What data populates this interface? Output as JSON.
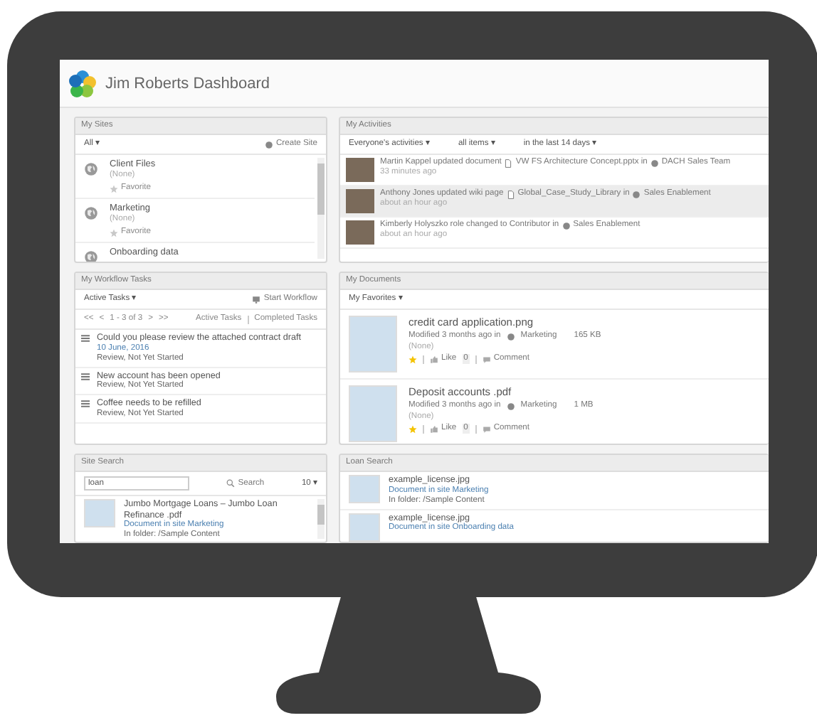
{
  "header": {
    "title": "Jim Roberts Dashboard"
  },
  "my_sites": {
    "title": "My Sites",
    "filter": "All ▾",
    "create": "Create Site",
    "items": [
      {
        "name": "Client Files",
        "description": "(None)",
        "favorite_label": "Favorite",
        "favorite": false
      },
      {
        "name": "Marketing",
        "description": "(None)",
        "favorite_label": "Favorite",
        "favorite": false
      },
      {
        "name": "Onboarding data"
      }
    ]
  },
  "my_activities": {
    "title": "My Activities",
    "filters": [
      "Everyone's activities ▾",
      "all items ▾",
      "in the last 14 days ▾"
    ],
    "items": [
      {
        "text": "Martin Kappel updated document",
        "document": "VW FS Architecture Concept.pptx in",
        "site": "DACH Sales Team",
        "time": "33 minutes ago",
        "highlighted": false
      },
      {
        "text": "Anthony Jones updated wiki page",
        "document": "Global_Case_Study_Library in",
        "site": "Sales Enablement",
        "time": "about an hour ago",
        "highlighted": true
      },
      {
        "text": "Kimberly Holyszko role changed to Contributor in",
        "site": "Sales Enablement",
        "time": "about an hour ago",
        "highlighted": false
      }
    ]
  },
  "my_workflow_tasks": {
    "title": "My Workflow Tasks",
    "filter": "Active Tasks ▾",
    "start": "Start Workflow",
    "pagination": [
      "<<",
      "<",
      "1 - 3 of 3",
      ">",
      ">>"
    ],
    "links": [
      "Active Tasks",
      "Completed Tasks"
    ],
    "tasks": [
      {
        "title": "Could you please review the attached contract draft",
        "date": "10 June, 2016",
        "status": "Review, Not Yet Started"
      },
      {
        "title": "New account has been opened",
        "status": "Review, Not Yet Started"
      },
      {
        "title": "Coffee needs to be refilled",
        "status": "Review, Not Yet Started"
      }
    ]
  },
  "my_documents": {
    "title": "My Documents",
    "filter": "My Favorites ▾",
    "items": [
      {
        "name": "credit card application.png",
        "modified": "Modified 3 months ago in",
        "site": "Marketing",
        "size": "165 KB",
        "description": "(None)",
        "favorite": true,
        "like": "Like",
        "likes": "0",
        "comment": "Comment"
      },
      {
        "name": "Deposit accounts .pdf",
        "modified": "Modified 3 months ago in",
        "site": "Marketing",
        "size": "1 MB",
        "description": "(None)",
        "favorite": true,
        "like": "Like",
        "likes": "0",
        "comment": "Comment"
      }
    ]
  },
  "site_search": {
    "title": "Site Search",
    "query": "loan",
    "button": "Search",
    "count": "10 ▾",
    "results": [
      {
        "name": "Jumbo Mortgage Loans – Jumbo Loan Refinance .pdf",
        "site": "Document in site Marketing",
        "folder": "In folder: /Sample Content"
      }
    ]
  },
  "loan_search": {
    "title": "Loan Search",
    "results": [
      {
        "name": "example_license.jpg",
        "site": "Document in site Marketing",
        "folder": "In folder: /Sample Content"
      },
      {
        "name": "example_license.jpg",
        "site": "Document in site Onboarding data"
      }
    ]
  }
}
